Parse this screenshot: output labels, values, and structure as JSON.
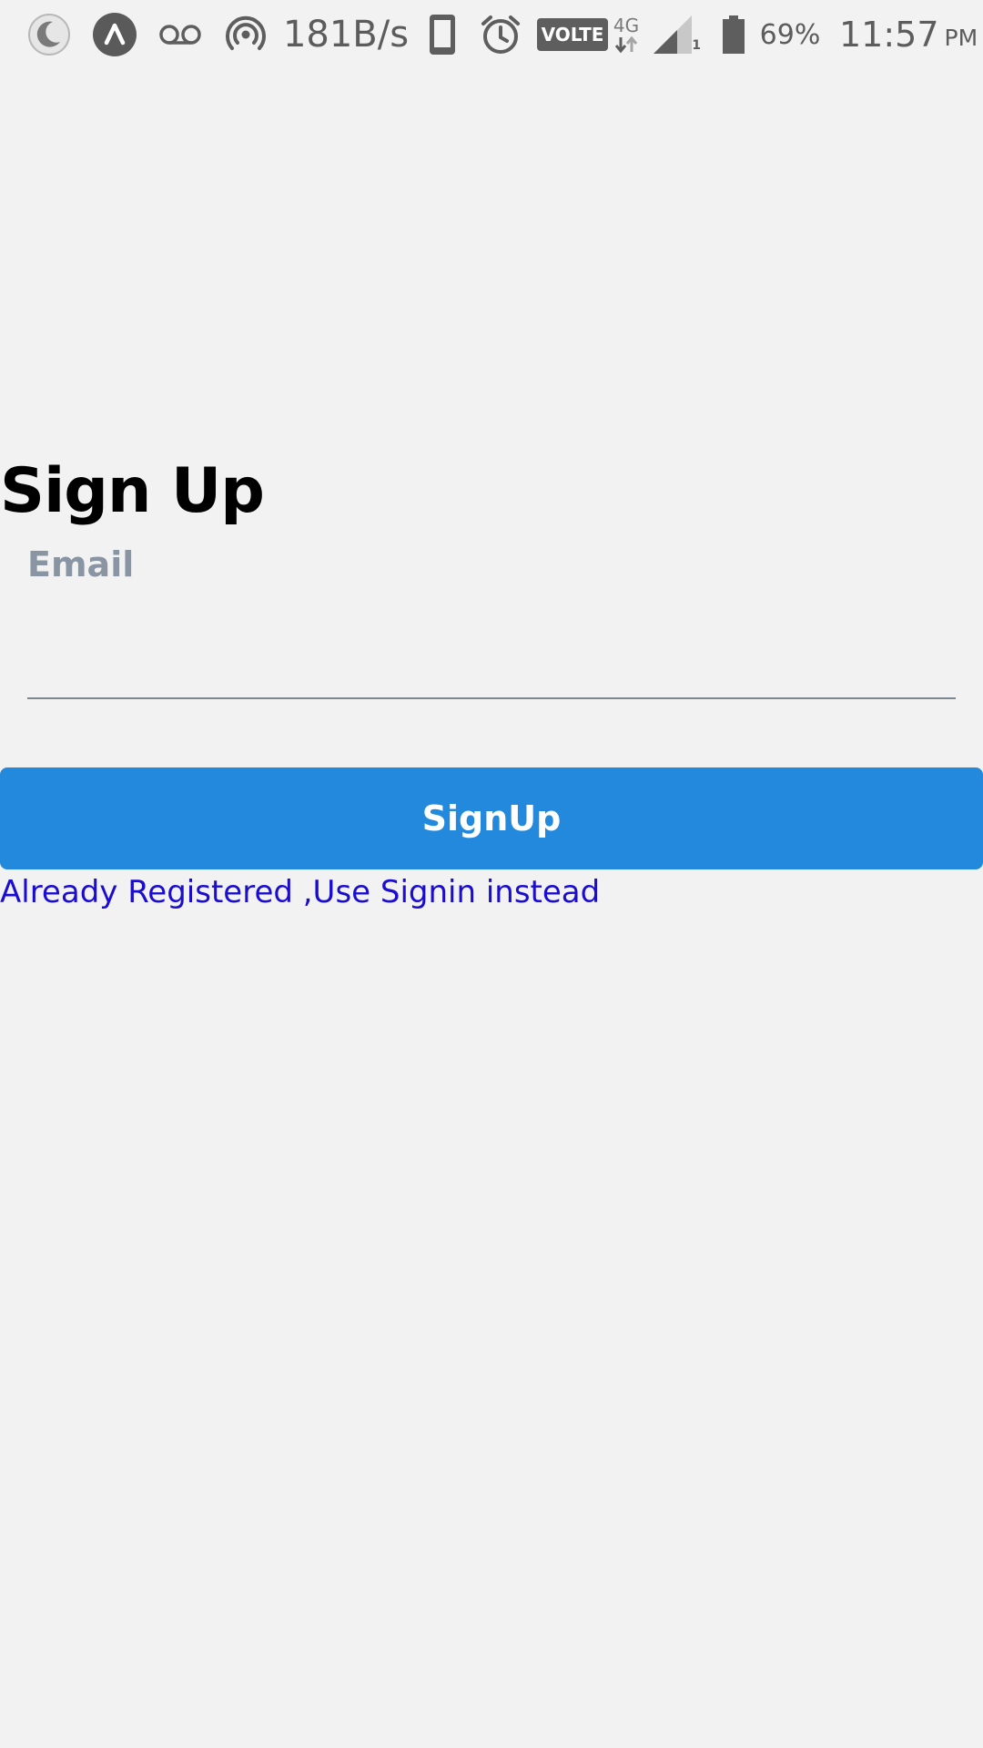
{
  "status_bar": {
    "icons": [
      "moon-icon",
      "app-launcher-icon",
      "voicemail-icon",
      "hotspot-icon",
      "phone-icon",
      "alarm-icon",
      "volte-badge",
      "signal-icon",
      "battery-icon"
    ],
    "network_speed": "181B/s",
    "volte_label": "VOLTE",
    "network_type": "4G",
    "sim_slot": "1",
    "battery_percent": "69%",
    "time": "11:57",
    "ampm": "PM"
  },
  "form": {
    "title": "Sign Up",
    "email_label": "Email",
    "email_value": "",
    "signup_button_label": "SignUp",
    "signin_link_text": "Already Registered ,Use Signin instead"
  },
  "colors": {
    "background": "#f2f2f3",
    "button": "#2289dc",
    "link": "#1a0dcf",
    "label": "#8a95a3"
  }
}
